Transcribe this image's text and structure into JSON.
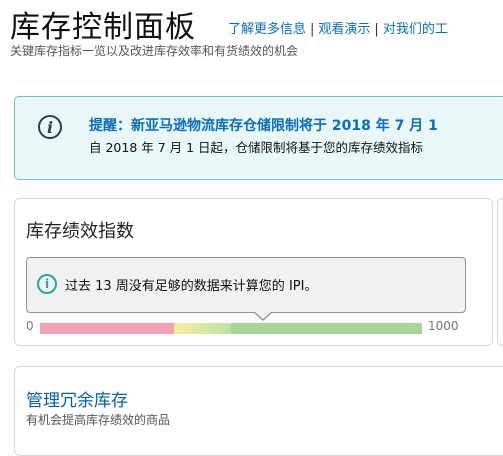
{
  "header": {
    "title": "库存控制面板",
    "links": [
      "了解更多信息",
      "观看演示",
      "对我们的工"
    ],
    "separator": "|",
    "subtitle": "关键库存指标一览以及改进库存效率和有货绩效的机会"
  },
  "alert": {
    "icon": "info-italic-icon",
    "title": "提醒：新亚马逊物流库存仓储限制将于 2018 年 7 月 1",
    "body": "自 2018 年 7 月 1 日起，仓储限制将基于您的库存绩效指标"
  },
  "ipi_card": {
    "title": "库存绩效指数",
    "info_text": "过去 13 周没有足够的数据来计算您的 IPI。",
    "info_icon": "info-circle-icon",
    "scale_min": "0",
    "scale_max": "1000"
  },
  "excess_card": {
    "title": "管理冗余库存",
    "subtitle": "有机会提高库存绩效的商品"
  },
  "colors": {
    "link": "#0a6ebd",
    "alert_bg": "#eaf7f9",
    "alert_border": "#6ec2cf",
    "bar_red": "#f2a3b3",
    "bar_green": "#a9d59a"
  }
}
